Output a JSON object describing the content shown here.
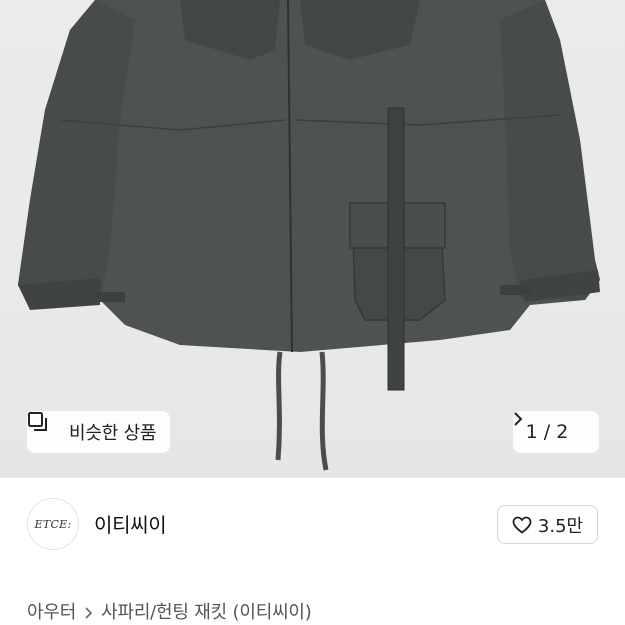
{
  "product": {
    "image_description_icon": "jacket-product-image",
    "similar_products_label": "비슷한 상품",
    "similar_products_icon": "overlapping-squares-icon",
    "pager_text": "1 / 2"
  },
  "shop": {
    "logo_text": "ETCE:",
    "name": "이티씨이",
    "like_count": "3.5만",
    "like_icon": "heart-outline-icon"
  },
  "breadcrumb": {
    "items": [
      "아우터",
      "사파리/헌팅 재킷 (이티씨이)"
    ]
  },
  "colors": {
    "jacket": "#4f5350",
    "background": "#e9e9e9"
  }
}
